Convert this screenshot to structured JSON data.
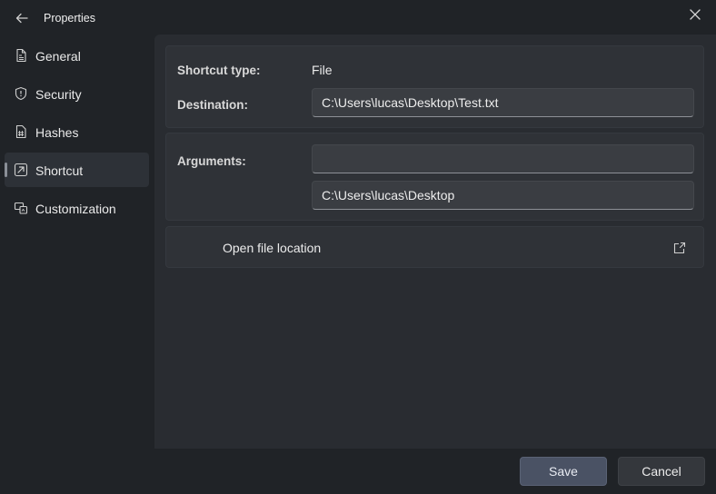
{
  "window": {
    "title": "Properties"
  },
  "sidebar": {
    "items": [
      {
        "label": "General",
        "icon": "document-icon",
        "active": false
      },
      {
        "label": "Security",
        "icon": "shield-icon",
        "active": false
      },
      {
        "label": "Hashes",
        "icon": "hash-icon",
        "active": false
      },
      {
        "label": "Shortcut",
        "icon": "shortcut-arrow-icon",
        "active": true
      },
      {
        "label": "Customization",
        "icon": "customize-icon",
        "active": false
      }
    ]
  },
  "shortcut": {
    "type_label": "Shortcut type:",
    "type_value": "File",
    "destination_label": "Destination:",
    "destination_value": "C:\\Users\\lucas\\Desktop\\Test.txt",
    "arguments_label": "Arguments:",
    "arguments_value": "",
    "working_dir_value": "C:\\Users\\lucas\\Desktop",
    "open_location_label": "Open file location"
  },
  "footer": {
    "save_label": "Save",
    "cancel_label": "Cancel"
  },
  "colors": {
    "window_bg": "#202327",
    "content_bg": "#292c31",
    "card_bg": "#2f3237",
    "save_button_bg": "#4a5264"
  }
}
